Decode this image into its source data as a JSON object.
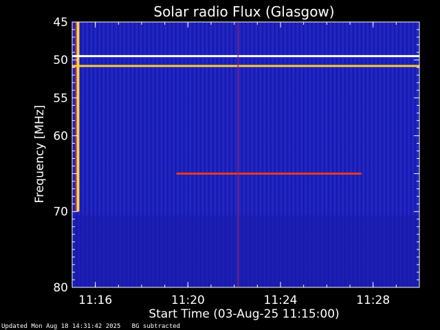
{
  "chart_data": {
    "type": "heatmap",
    "title": "Solar radio Flux (Glasgow)",
    "xlabel": "Start Time (03-Aug-25 11:15:00)",
    "ylabel": "Frequency [MHz]",
    "x_range": [
      "11:15:00",
      "11:30:00"
    ],
    "y_range": [
      45,
      80
    ],
    "y_ticks": [
      45,
      50,
      55,
      60,
      65,
      70,
      80
    ],
    "y_tick_labels": [
      "45",
      "50",
      "55",
      "60",
      "",
      "70",
      "80"
    ],
    "x_ticks": [
      "11:16",
      "11:20",
      "11:24",
      "11:28"
    ],
    "features": [
      {
        "kind": "broadband-burst",
        "time": "11:15:15",
        "freq_range": [
          45,
          70
        ],
        "color": "#ffd24a"
      },
      {
        "kind": "interference-line",
        "freq": 49.5,
        "time_range": [
          "11:15:00",
          "11:30:00"
        ],
        "color": "#ffffff"
      },
      {
        "kind": "interference-line",
        "freq": 50.8,
        "time_range": [
          "11:15:00",
          "11:30:00"
        ],
        "color": "#ffcc33"
      },
      {
        "kind": "interference-line",
        "freq": 65.0,
        "time_range": [
          "11:19:30",
          "11:27:30"
        ],
        "color": "#e83a1a"
      },
      {
        "kind": "vertical-streak",
        "time": "11:22:10",
        "freq_range": [
          45,
          80
        ],
        "color": "#9a2a6a"
      }
    ],
    "colors": {
      "background": "#1a1ab4",
      "axis": "#ffffff"
    }
  },
  "footer": {
    "updated": "Updated Mon Aug 18 14:31:42 2025",
    "note": "BG subtracted"
  }
}
